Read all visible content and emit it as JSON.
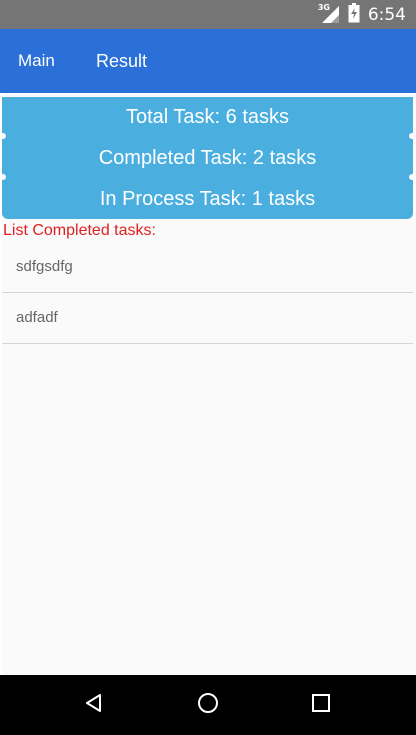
{
  "status_bar": {
    "network": "3G",
    "time": "6:54",
    "icons": [
      "signal-icon",
      "battery-icon"
    ]
  },
  "tabs": [
    {
      "label": "Main"
    },
    {
      "label": "Result"
    }
  ],
  "summary": {
    "total": "Total Task: 6 tasks",
    "completed": "Completed Task: 2 tasks",
    "in_process": "In Process Task: 1 tasks"
  },
  "list": {
    "header": "List Completed tasks:",
    "items": [
      {
        "label": "sdfgsdfg"
      },
      {
        "label": "adfadf"
      }
    ]
  },
  "nav_bar": {
    "icons": [
      "back-icon",
      "home-icon",
      "recents-icon"
    ]
  },
  "colors": {
    "status_bar": "#757575",
    "action_bar": "#2b6fd8",
    "summary_bg": "#4aaedf",
    "header_text": "#e02020",
    "nav_bar": "#000000"
  }
}
